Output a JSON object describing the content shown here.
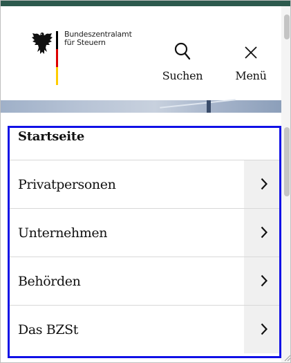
{
  "header": {
    "logo_line1": "Bundeszentralamt",
    "logo_line2": "für Steuern",
    "flag_colors": [
      "#000000",
      "#dd0000",
      "#ffcc00"
    ],
    "search_icon": "search-icon",
    "search_label": "Suchen",
    "menu_icon": "close-icon",
    "menu_label": "Menü"
  },
  "nav": {
    "home_label": "Startseite",
    "items": [
      {
        "label": "Privatpersonen",
        "icon": "chevron-right-icon"
      },
      {
        "label": "Unternehmen",
        "icon": "chevron-right-icon"
      },
      {
        "label": "Behörden",
        "icon": "chevron-right-icon"
      },
      {
        "label": "Das BZSt",
        "icon": "chevron-right-icon"
      }
    ]
  },
  "colors": {
    "brand_bar": "#2d5a4d",
    "highlight": "#1010e6",
    "chevron_cell": "#f0f0f0"
  }
}
